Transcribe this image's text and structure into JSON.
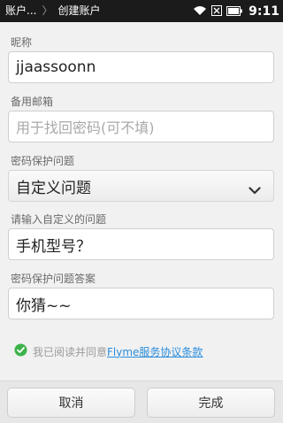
{
  "status_bar": {
    "breadcrumb_parent": "账户...",
    "breadcrumb_current": "创建账户",
    "time": "9:11"
  },
  "form": {
    "nickname": {
      "label": "昵称",
      "value": "jjaassoonn"
    },
    "backup_email": {
      "label": "备用邮箱",
      "placeholder": "用于找回密码(可不填)"
    },
    "security_question": {
      "label": "密码保护问题",
      "value": "自定义问题"
    },
    "custom_question": {
      "label": "请输入自定义的问题",
      "value": "手机型号？"
    },
    "answer": {
      "label": "密码保护问题答案",
      "value": "你猜~~"
    }
  },
  "agreement": {
    "text": "我已阅读并同意",
    "link": "Flyme服务协议条款",
    "checked": true,
    "check_color": "#3cb34a"
  },
  "buttons": {
    "cancel": "取消",
    "done": "完成"
  },
  "icons": [
    "wifi-icon",
    "sim-icon",
    "battery-icon",
    "chevron-down-icon",
    "check-circle-icon"
  ]
}
